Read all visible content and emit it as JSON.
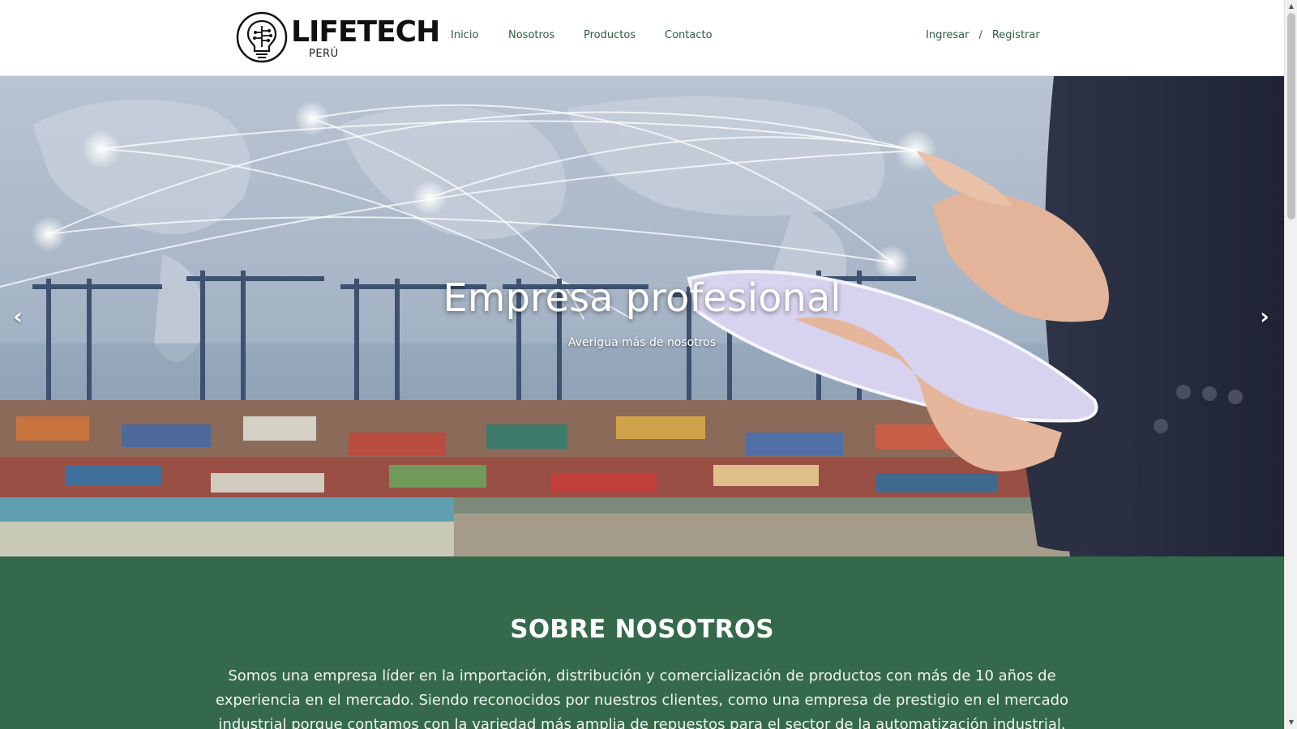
{
  "brand": {
    "name": "LIFETECH",
    "subtitle": "PERÚ"
  },
  "nav": {
    "items": [
      {
        "label": "Inicio"
      },
      {
        "label": "Nosotros"
      },
      {
        "label": "Productos"
      },
      {
        "label": "Contacto"
      }
    ]
  },
  "auth": {
    "login": "Ingresar",
    "separator": "/",
    "register": "Registrar"
  },
  "hero": {
    "title": "Empresa profesional",
    "subtitle": "Averigua más de nosotros",
    "prev_icon": "chevron-left-icon",
    "next_icon": "chevron-right-icon",
    "prev_glyph": "‹",
    "next_glyph": "›"
  },
  "about": {
    "title": "SOBRE NOSOTROS",
    "text": "Somos una empresa líder en la importación, distribución y comercialización de productos con más de 10 años de experiencia en el mercado. Siendo reconocidos por nuestros clientes, como una empresa de prestigio en el mercado industrial porque contamos con la variedad más amplia de repuestos para el sector de la automatización industrial."
  },
  "colors": {
    "nav_text": "#2f5b44",
    "about_bg": "#346a4b"
  }
}
